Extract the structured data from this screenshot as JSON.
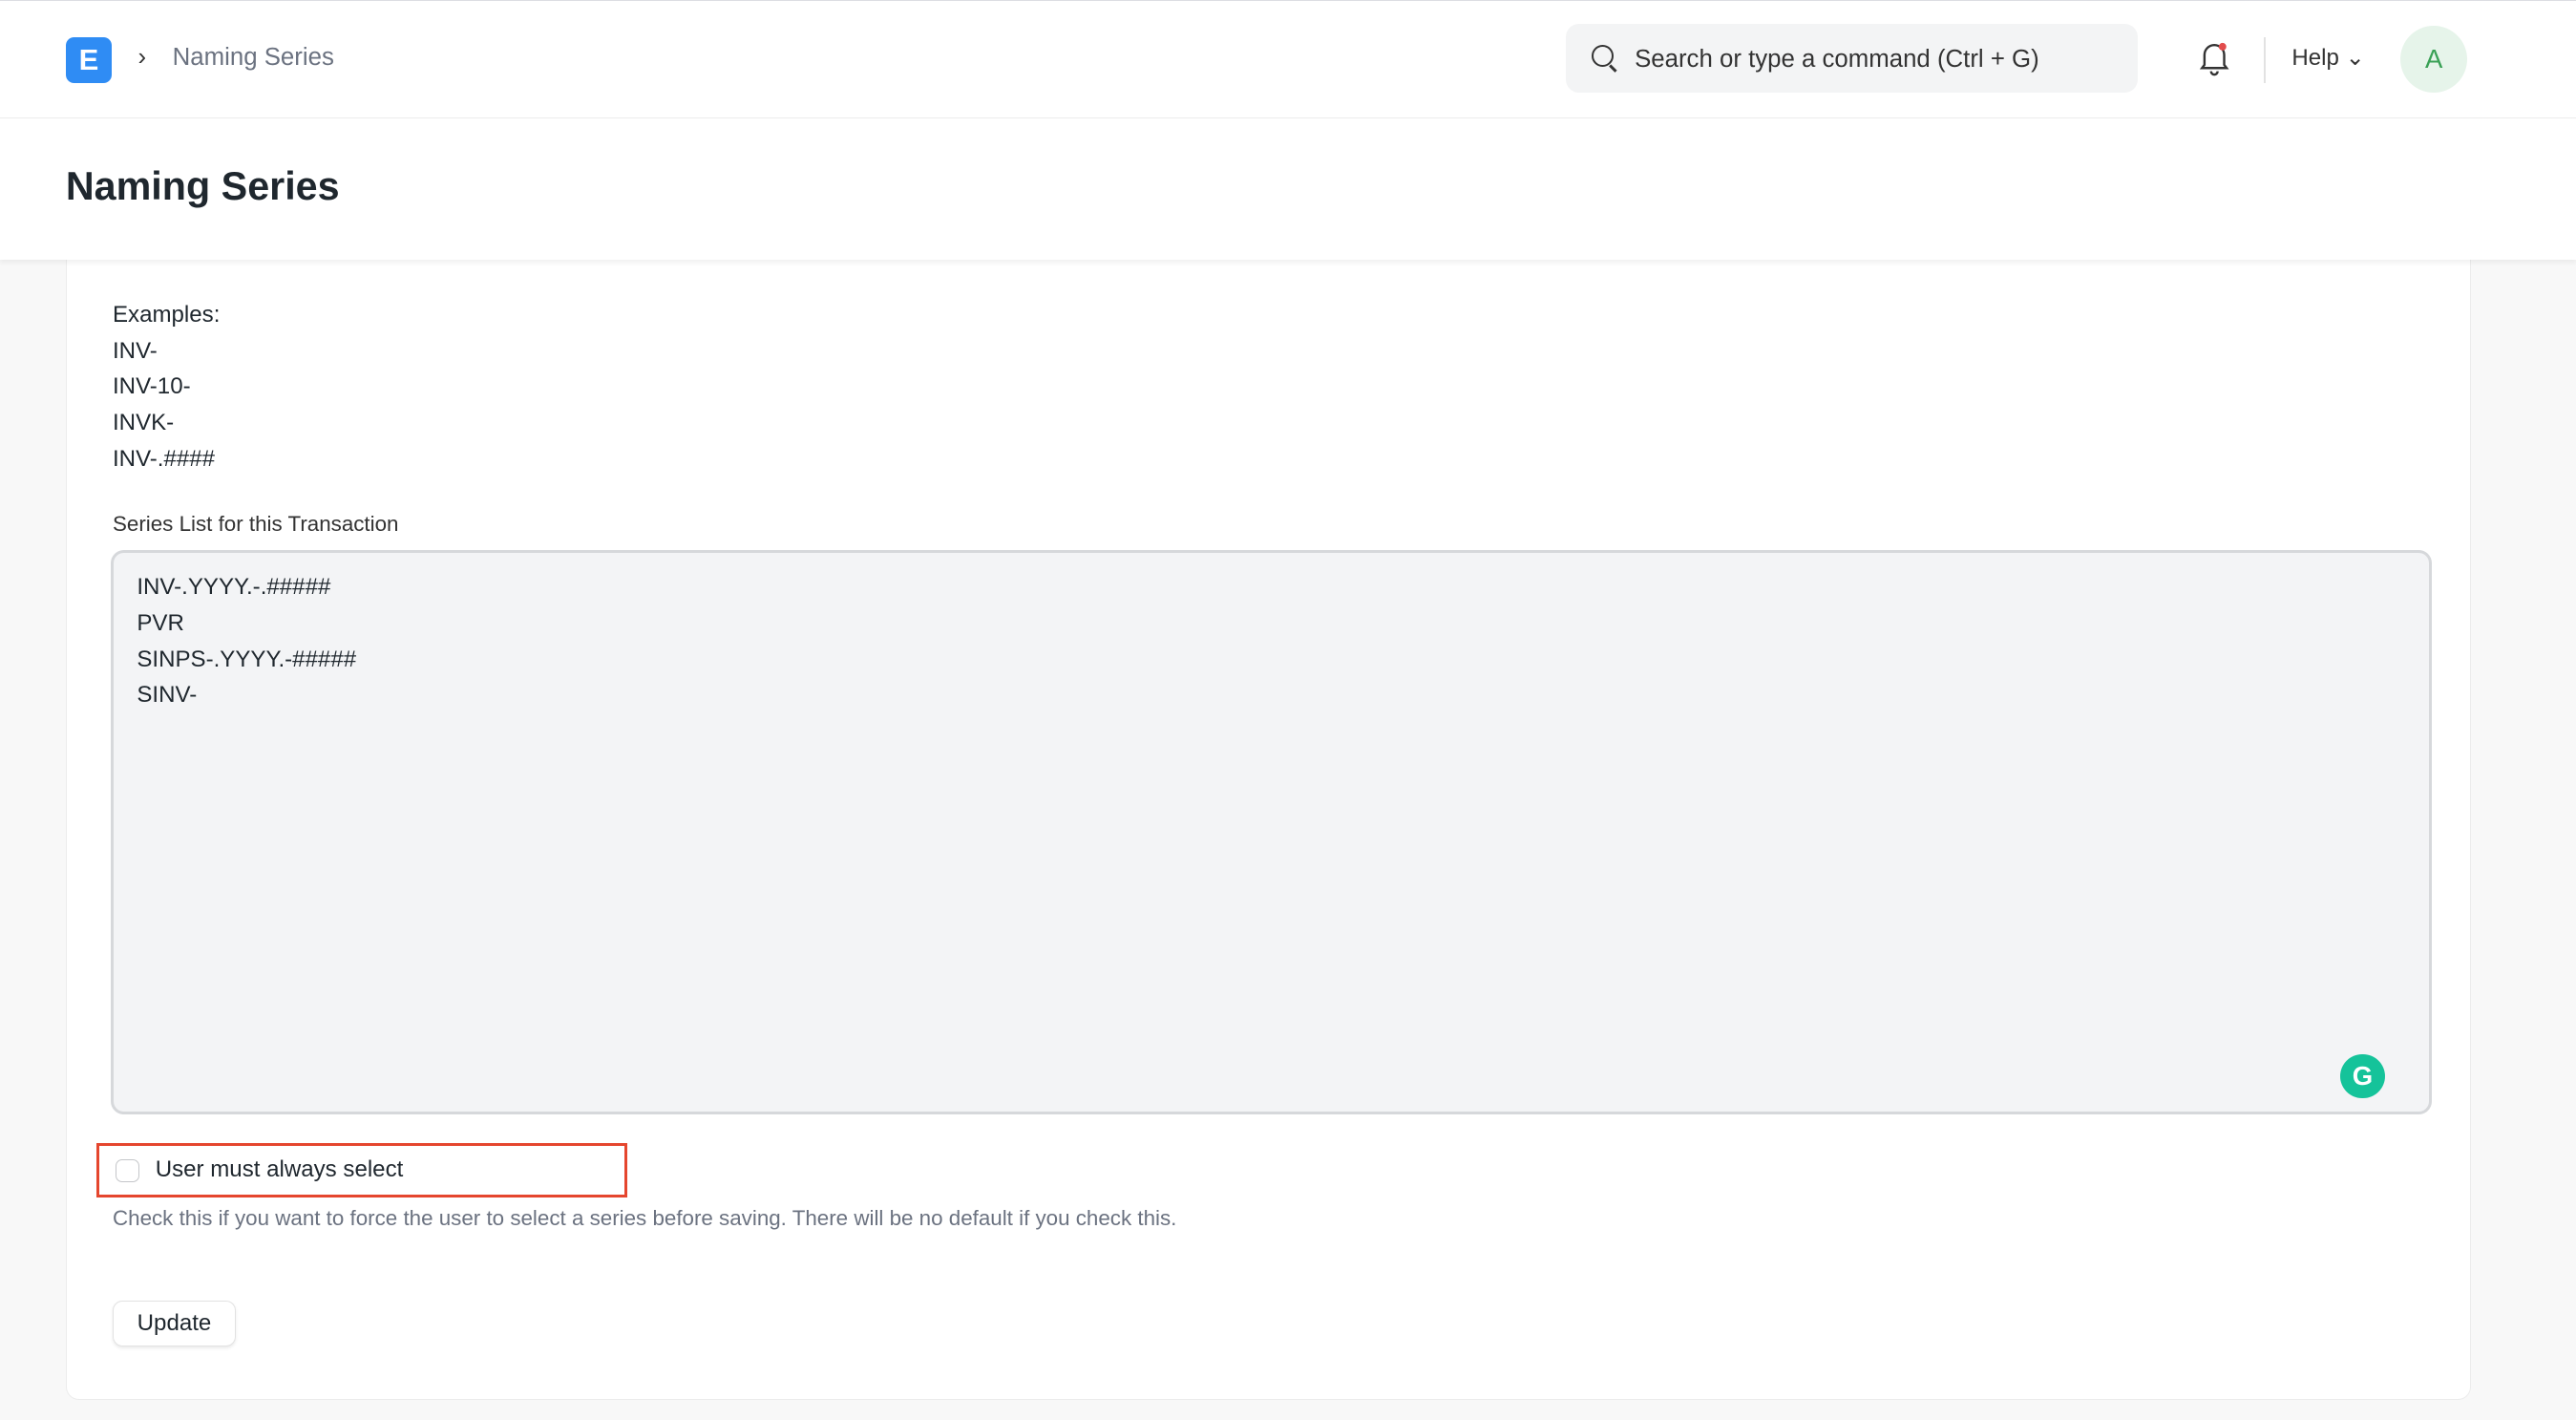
{
  "navbar": {
    "logo_letter": "E",
    "breadcrumb": "Naming Series",
    "search_placeholder": "Search or type a command (Ctrl + G)",
    "help_label": "Help",
    "avatar_letter": "A"
  },
  "page": {
    "title": "Naming Series"
  },
  "form": {
    "examples": [
      "Examples:",
      "INV-",
      "INV-10-",
      "INVK-",
      "INV-.####"
    ],
    "series_label": "Series List for this Transaction",
    "series_value": "INV-.YYYY.-.#####\nPVR\nSINPS-.YYYY.-#####\nSINV-",
    "checkbox_label": "User must always select",
    "checkbox_checked": false,
    "checkbox_description": "Check this if you want to force the user to select a series before saving. There will be no default if you check this.",
    "update_label": "Update"
  },
  "colors": {
    "accent": "#2f8cf4",
    "highlight": "#e5462e",
    "grammarly": "#15c39a"
  }
}
